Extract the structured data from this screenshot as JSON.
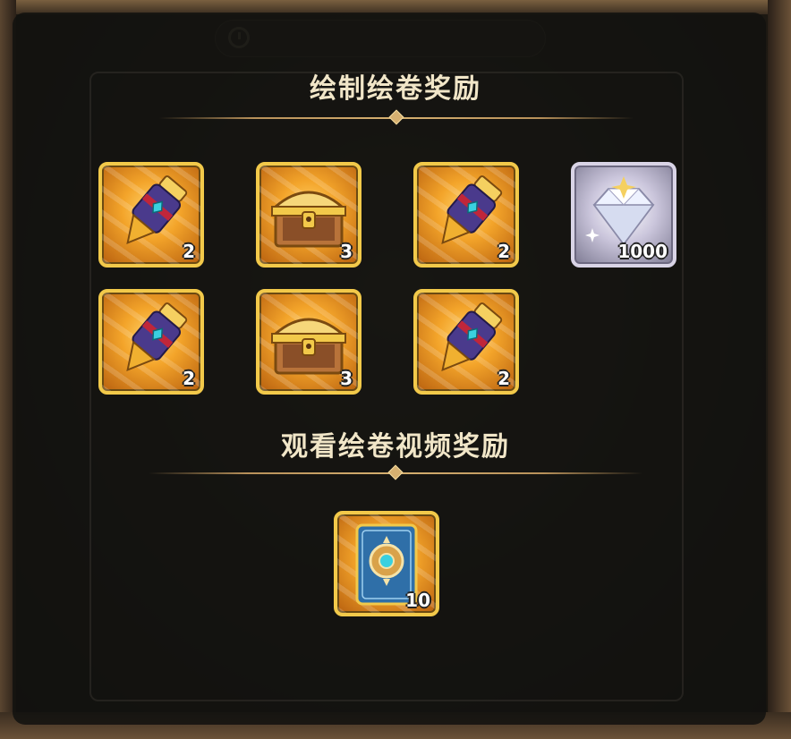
{
  "section1": {
    "title": "绘制绘卷奖励"
  },
  "section2": {
    "title": "观看绘卷视频奖励"
  },
  "rewards": [
    {
      "icon": "scroll-gauntlet-icon",
      "count": "2"
    },
    {
      "icon": "treasure-chest-icon",
      "count": "3"
    },
    {
      "icon": "scroll-gauntlet-icon",
      "count": "2"
    },
    {
      "icon": "diamond-icon",
      "count": "1000"
    },
    {
      "icon": "scroll-gauntlet-icon",
      "count": "2"
    },
    {
      "icon": "treasure-chest-icon",
      "count": "3"
    },
    {
      "icon": "scroll-gauntlet-icon",
      "count": "2"
    }
  ],
  "video_reward": {
    "icon": "card-icon",
    "count": "10"
  },
  "colors": {
    "gold_border": "#f2c94a",
    "title": "#f1e6c8",
    "divider": "#b8915a"
  }
}
